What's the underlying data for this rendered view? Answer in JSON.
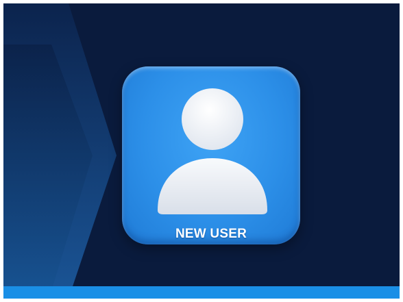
{
  "app_tile": {
    "label": "NEW USER",
    "icon": "user-icon"
  },
  "colors": {
    "background": "#0a1b3d",
    "tile_blue": "#2c8fe8",
    "bottom_strip": "#1a8fe6",
    "glyph": "#eef1f6"
  }
}
